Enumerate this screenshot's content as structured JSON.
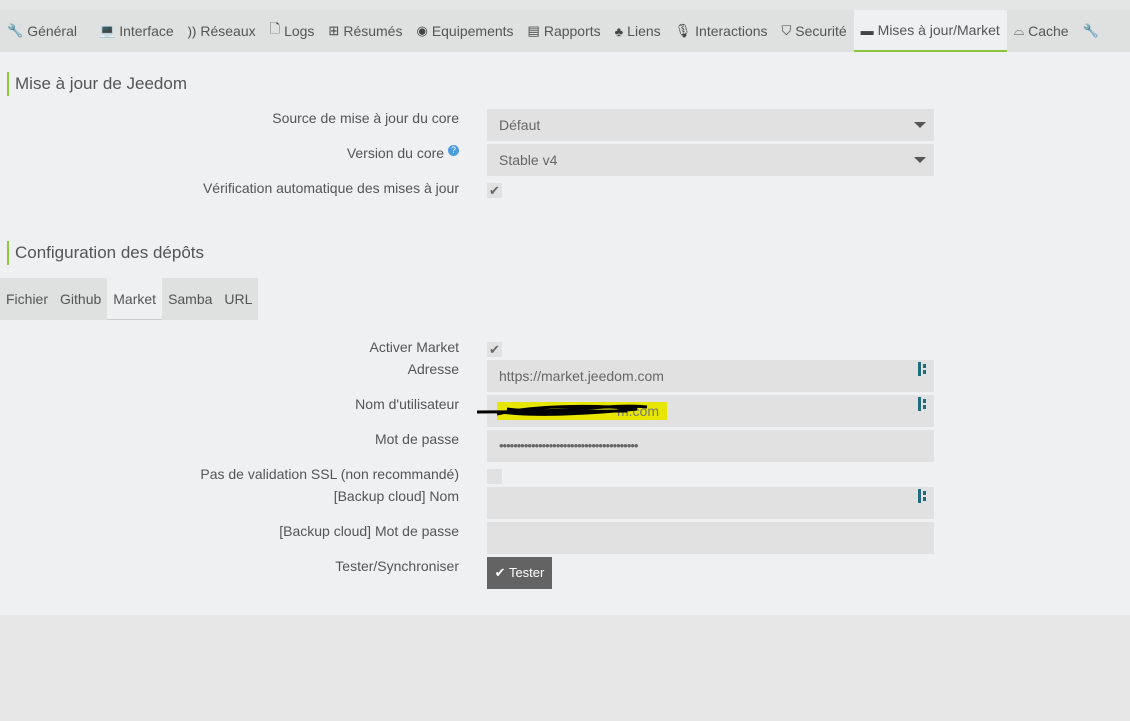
{
  "tabs": [
    {
      "label": "Général",
      "icon": "wrench-icon",
      "glyph": "🔧"
    },
    {
      "label": "Interface",
      "icon": "laptop-icon",
      "glyph": "💻"
    },
    {
      "label": "Réseaux",
      "icon": "rss-icon",
      "glyph": "))"
    },
    {
      "label": "Logs",
      "icon": "file-icon",
      "glyph": "🗋"
    },
    {
      "label": "Résumés",
      "icon": "table-icon",
      "glyph": "⊞"
    },
    {
      "label": "Equipements",
      "icon": "equipment-icon",
      "glyph": "◉"
    },
    {
      "label": "Rapports",
      "icon": "report-icon",
      "glyph": "▤"
    },
    {
      "label": "Liens",
      "icon": "sitemap-icon",
      "glyph": "♣"
    },
    {
      "label": "Interactions",
      "icon": "microphone-icon",
      "glyph": "🎙"
    },
    {
      "label": "Securité",
      "icon": "shield-icon",
      "glyph": "⛉"
    },
    {
      "label": "Mises à jour/Market",
      "icon": "credit-card-icon",
      "glyph": "▬"
    },
    {
      "label": "Cache",
      "icon": "hdd-icon",
      "glyph": "⌓"
    },
    {
      "label": "",
      "icon": "wrench-icon",
      "glyph": "🔧"
    }
  ],
  "update": {
    "title": "Mise à jour de Jeedom",
    "source_label": "Source de mise à jour du core",
    "source_value": "Défaut",
    "version_label": "Version du core",
    "version_value": "Stable v4",
    "autocheck_label": "Vérification automatique des mises à jour",
    "autocheck": true
  },
  "repos": {
    "title": "Configuration des dépôts",
    "tabs": [
      "Fichier",
      "Github",
      "Market",
      "Samba",
      "URL"
    ],
    "active_tab": "Market",
    "enable_label": "Activer Market",
    "enable": true,
    "address_label": "Adresse",
    "address_value": "https://market.jeedom.com",
    "user_label": "Nom d'utilisateur",
    "user_value": "m.com",
    "password_label": "Mot de passe",
    "password_value": "•••••••••••••••••••••••••••••••••••••••",
    "ssl_label": "Pas de validation SSL (non recommandé)",
    "ssl": false,
    "backup_name_label": "[Backup cloud] Nom",
    "backup_pass_label": "[Backup cloud] Mot de passe",
    "test_label": "Tester/Synchroniser",
    "test_button": "Tester"
  },
  "colors": {
    "accent": "#8cc63f",
    "highlight": "#e6e600"
  }
}
